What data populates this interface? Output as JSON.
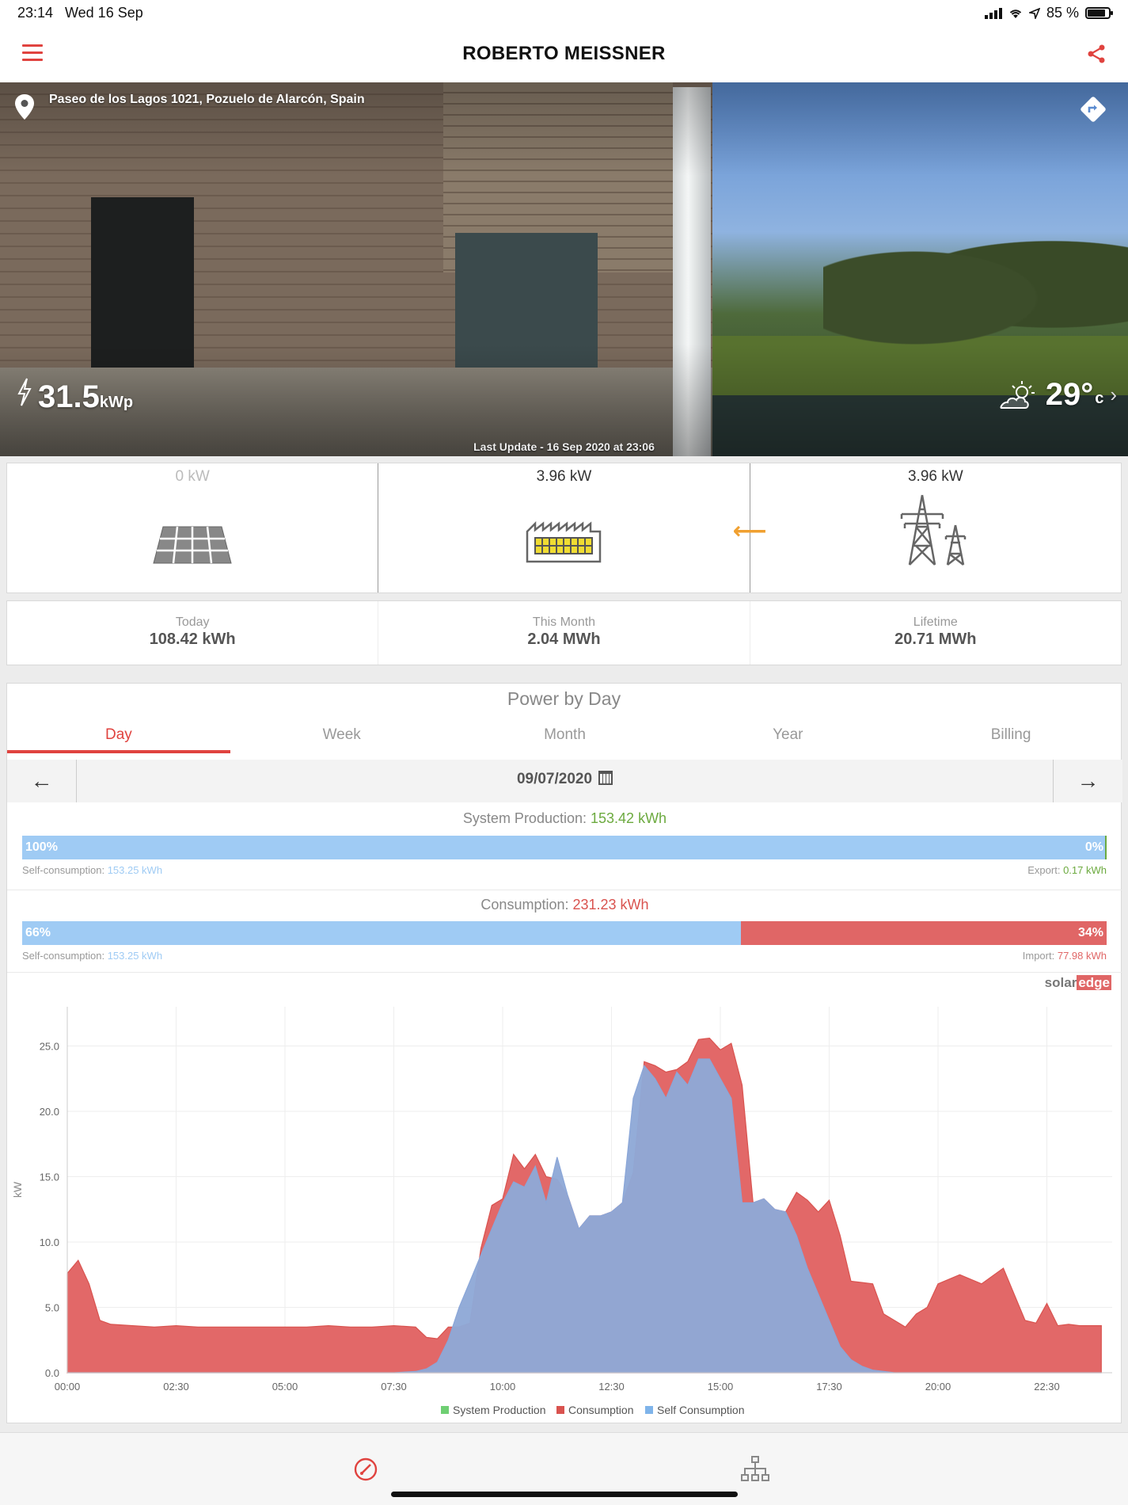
{
  "status": {
    "time": "23:14",
    "date": "Wed 16 Sep",
    "battery": "85 %"
  },
  "header": {
    "title": "ROBERTO MEISSNER",
    "menu_icon": "hamburger-menu-icon",
    "share_icon": "share-icon"
  },
  "site": {
    "address": "Paseo de los Lagos 1021, Pozuelo de Alarcón, Spain",
    "peak_value": "31.5",
    "peak_unit": "kWp",
    "temperature": "29°",
    "temp_unit": "c",
    "last_update": "Last Update - 16 Sep 2020 at 23:06"
  },
  "flow": {
    "solar_kw": "0 kW",
    "load_kw": "3.96 kW",
    "grid_kw": "3.96 kW"
  },
  "summary": [
    {
      "label": "Today",
      "value": "108.42 kWh"
    },
    {
      "label": "This Month",
      "value": "2.04 MWh"
    },
    {
      "label": "Lifetime",
      "value": "20.71 MWh"
    }
  ],
  "power": {
    "title": "Power by Day",
    "tabs": [
      "Day",
      "Week",
      "Month",
      "Year",
      "Billing"
    ],
    "active_tab": "Day",
    "date": "09/07/2020",
    "production": {
      "label": "System Production:",
      "value": "153.42 kWh",
      "self_pct": "100%",
      "export_pct": "0%",
      "self_fraction": 0.9989,
      "self_label": "Self-consumption:",
      "self_value": "153.25 kWh",
      "export_label": "Export:",
      "export_value": "0.17 kWh"
    },
    "consumption": {
      "label": "Consumption:",
      "value": "231.23 kWh",
      "self_pct": "66%",
      "import_pct": "34%",
      "self_fraction": 0.6627,
      "self_label": "Self-consumption:",
      "self_value": "153.25 kWh",
      "import_label": "Import:",
      "import_value": "77.98 kWh"
    },
    "brand": {
      "a": "solar",
      "b": "edge"
    }
  },
  "chart_data": {
    "type": "area",
    "xlabel": "",
    "ylabel": "kW",
    "ylim": [
      0,
      28
    ],
    "y_ticks": [
      "0.0",
      "5.0",
      "10.0",
      "15.0",
      "20.0",
      "25.0"
    ],
    "x_ticks": [
      "00:00",
      "02:30",
      "05:00",
      "07:30",
      "10:00",
      "12:30",
      "15:00",
      "17:30",
      "20:00",
      "22:30"
    ],
    "x_hours": [
      0,
      0.25,
      0.5,
      0.75,
      1,
      1.5,
      2,
      2.5,
      3,
      3.5,
      4,
      4.5,
      5,
      5.5,
      6,
      6.5,
      7,
      7.5,
      8,
      8.25,
      8.5,
      8.75,
      9,
      9.25,
      9.5,
      9.75,
      10,
      10.25,
      10.5,
      10.75,
      11,
      11.25,
      11.5,
      11.75,
      12,
      12.25,
      12.5,
      12.75,
      13,
      13.25,
      13.5,
      13.75,
      14,
      14.25,
      14.5,
      14.75,
      15,
      15.25,
      15.5,
      15.75,
      16,
      16.25,
      16.5,
      16.75,
      17,
      17.25,
      17.5,
      17.75,
      18,
      18.25,
      18.5,
      18.75,
      19,
      19.25,
      19.5,
      19.75,
      20,
      20.5,
      21,
      21.5,
      22,
      22.25,
      22.5,
      22.75,
      23,
      23.25,
      23.5,
      23.75
    ],
    "series": [
      {
        "name": "System Production",
        "color": "#6fcf73",
        "values": [
          0,
          0,
          0,
          0,
          0,
          0,
          0,
          0,
          0,
          0,
          0,
          0,
          0,
          0,
          0,
          0,
          0,
          0,
          0.1,
          0.3,
          0.8,
          2.5,
          5,
          7,
          9,
          11,
          13,
          14.6,
          14.2,
          15.8,
          13,
          16.5,
          13.5,
          11,
          12,
          12,
          12.3,
          13,
          21,
          23.5,
          22.5,
          21,
          23,
          22,
          24,
          24,
          22.5,
          21,
          13,
          13,
          13.3,
          12.5,
          12.3,
          10.5,
          8,
          6,
          4,
          2,
          1,
          0.5,
          0.2,
          0.1,
          0,
          0,
          0,
          0,
          0,
          0,
          0,
          0,
          0,
          0,
          0,
          0,
          0,
          0,
          0,
          0
        ]
      },
      {
        "name": "Consumption",
        "color": "#d9534f",
        "values": [
          7.6,
          8.6,
          6.8,
          4,
          3.7,
          3.6,
          3.5,
          3.6,
          3.5,
          3.5,
          3.5,
          3.5,
          3.5,
          3.5,
          3.6,
          3.5,
          3.5,
          3.6,
          3.5,
          2.7,
          2.6,
          3.5,
          3.5,
          3.8,
          9.5,
          12.8,
          13.3,
          16.7,
          15.6,
          16.7,
          15,
          14.8,
          13.5,
          11,
          12,
          12,
          12.3,
          13,
          15.3,
          23.8,
          23.5,
          23,
          23.2,
          23.8,
          25.5,
          25.6,
          24.7,
          25.2,
          22,
          13,
          13.3,
          12.5,
          12.3,
          13.8,
          13.2,
          12.3,
          13.2,
          10.5,
          7,
          6.9,
          6.8,
          4.5,
          4,
          3.5,
          4.5,
          5,
          6.8,
          7.5,
          6.8,
          8,
          4,
          3.8,
          5.3,
          3.6,
          3.7,
          3.6,
          3.6,
          3.6
        ]
      },
      {
        "name": "Self Consumption",
        "color": "#8fa8d8",
        "values": [
          0,
          0,
          0,
          0,
          0,
          0,
          0,
          0,
          0,
          0,
          0,
          0,
          0,
          0,
          0,
          0,
          0,
          0,
          0.1,
          0.3,
          0.8,
          2.5,
          5,
          7,
          9,
          11,
          13,
          14.6,
          14.2,
          15.8,
          13,
          16.5,
          13.5,
          11,
          12,
          12,
          12.3,
          13,
          21,
          23.5,
          22.5,
          21,
          23,
          22,
          24,
          24,
          22.5,
          21,
          13,
          13,
          13.3,
          12.5,
          12.3,
          10.5,
          8,
          6,
          4,
          2,
          1,
          0.5,
          0.2,
          0.1,
          0,
          0,
          0,
          0,
          0,
          0,
          0,
          0,
          0,
          0,
          0,
          0,
          0,
          0,
          0,
          0
        ]
      }
    ],
    "legend": [
      "System Production",
      "Consumption",
      "Self Consumption"
    ],
    "legend_position": "bottom",
    "grid": true
  },
  "bottomnav": [
    {
      "icon": "dashboard-gauge-icon",
      "active": true
    },
    {
      "icon": "site-layout-icon",
      "active": false
    }
  ]
}
